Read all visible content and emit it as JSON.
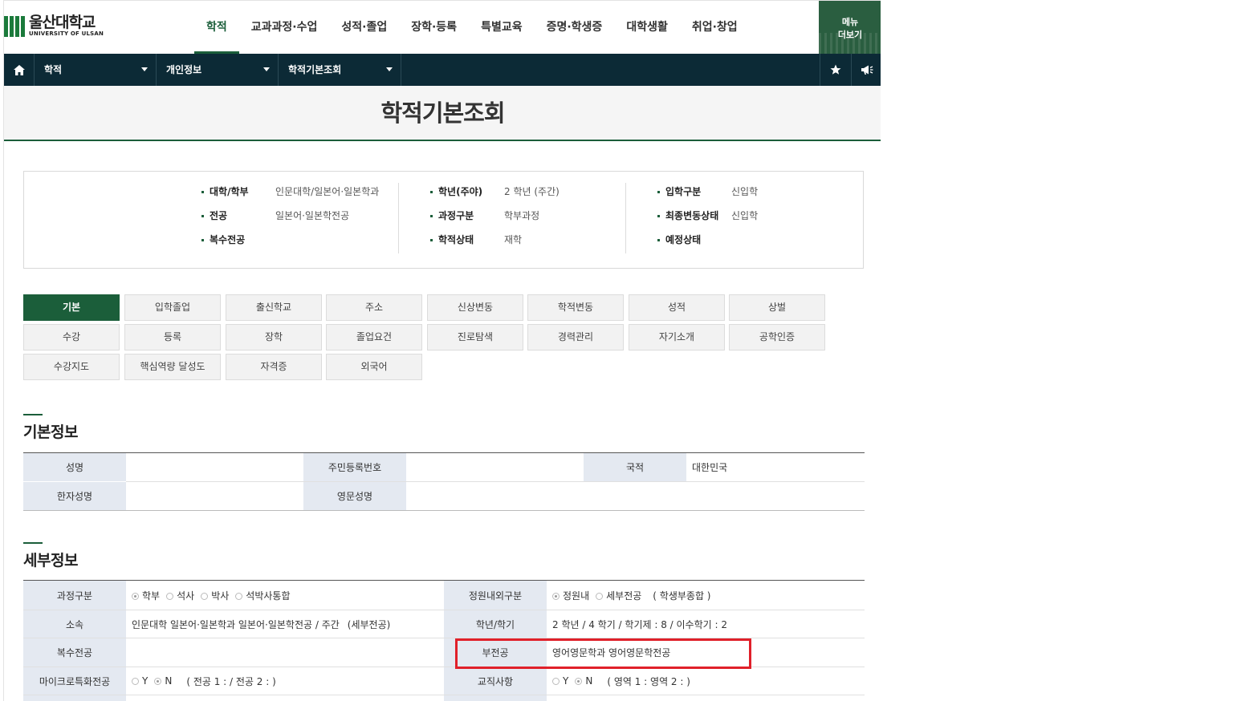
{
  "logo": {
    "name": "울산대학교",
    "name_en": "UNIVERSITY OF ULSAN"
  },
  "gnb": [
    "학적",
    "교과과정·수업",
    "성적·졸업",
    "장학·등록",
    "특별교육",
    "증명·학생증",
    "대학생활",
    "취업·창업"
  ],
  "more_button": {
    "line1": "메뉴",
    "line2": "더보기"
  },
  "location": {
    "home_icon": "home-icon",
    "level1": "학적",
    "level2": "개인정보",
    "level3": "학적기본조회",
    "star_icon": "star-icon",
    "announce_icon": "megaphone-icon"
  },
  "page_title": "학적기본조회",
  "summary": {
    "col1": [
      {
        "label": "대학/학부",
        "value": "인문대학/일본어·일본학과"
      },
      {
        "label": "전공",
        "value": "일본어·일본학전공"
      },
      {
        "label": "복수전공",
        "value": ""
      }
    ],
    "col2": [
      {
        "label": "학년(주야)",
        "value": "2 학년 (주간)"
      },
      {
        "label": "과정구분",
        "value": "학부과정"
      },
      {
        "label": "학적상태",
        "value": "재학"
      }
    ],
    "col3": [
      {
        "label": "입학구분",
        "value": "신입학"
      },
      {
        "label": "최종변동상태",
        "value": "신입학"
      },
      {
        "label": "예정상태",
        "value": ""
      }
    ]
  },
  "tabs": [
    [
      "기본",
      "입학졸업",
      "출신학교",
      "주소",
      "신상변동",
      "학적변동",
      "성적",
      "상벌"
    ],
    [
      "수강",
      "등록",
      "장학",
      "졸업요건",
      "진로탐색",
      "경력관리",
      "자기소개",
      "공학인증"
    ],
    [
      "수강지도",
      "핵심역량 달성도",
      "자격증",
      "외국어"
    ]
  ],
  "basic": {
    "title": "기본정보",
    "name_label": "성명",
    "name_value": "",
    "rrn_label": "주민등록번호",
    "rrn_value": "",
    "nationality_label": "국적",
    "nationality_value": "대한민국",
    "hanja_label": "한자성명",
    "hanja_value": "",
    "eng_label": "영문성명",
    "eng_value": ""
  },
  "detail": {
    "title": "세부정보",
    "course_label": "과정구분",
    "course_options": [
      "학부",
      "석사",
      "박사",
      "석박사통합"
    ],
    "quota_label": "정원내외구분",
    "quota_options": [
      "정원내",
      "세부전공"
    ],
    "quota_note": "( 학생부종합 )",
    "affil_label": "소속",
    "affil_value": "인문대학 일본어·일본학과 일본어·일본학전공 / 주간",
    "affil_note": "(세부전공)",
    "grade_label": "학년/학기",
    "grade_value": "2 학년 / 4 학기 /  학기제 : 8 /  이수학기 : 2",
    "double_label": "복수전공",
    "double_value": "",
    "minor_label": "부전공",
    "minor_value": "영어영문학과 영어영문학전공",
    "micro_label": "마이크로특화전공",
    "micro_options": [
      "Y",
      "N"
    ],
    "micro_note": "( 전공 1 : / 전공 2 : )",
    "teach_label": "교직사항",
    "teach_options": [
      "Y",
      "N"
    ],
    "teach_note": "( 영역 1 : 영역 2 : )"
  }
}
